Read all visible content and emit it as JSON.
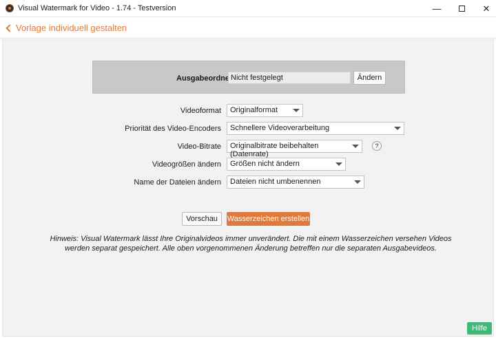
{
  "window": {
    "title": "Visual Watermark for Video - 1.74 - Testversion",
    "minimize": "—",
    "close": "✕"
  },
  "header": {
    "back_label": "Vorlage individuell gestalten"
  },
  "output": {
    "label": "Ausgabeordner",
    "value": "Nicht festgelegt",
    "change_button": "Ändern"
  },
  "form": {
    "videoformat": {
      "label": "Videoformat",
      "value": "Originalformat"
    },
    "encoder_priority": {
      "label": "Priorität des Video-Encoders",
      "value": "Schnellere Videoverarbeitung"
    },
    "bitrate": {
      "label": "Video-Bitrate",
      "value": "Originalbitrate beibehalten (Datenrate)",
      "help": "?"
    },
    "resize": {
      "label": "Videogrößen ändern",
      "value": "Größen nicht ändern"
    },
    "rename": {
      "label": "Name der Dateien ändern",
      "value": "Dateien nicht umbenennen"
    }
  },
  "actions": {
    "preview": "Vorschau",
    "create": "Wasserzeichen erstellen"
  },
  "hint": {
    "line1": "Hinweis: Visual Watermark lässt Ihre Originalvideos immer unverändert. Die mit einem Wasserzeichen versehen Videos",
    "line2": "werden separat gespeichert. Alle oben vorgenommenen Änderung betreffen nur die separaten Ausgabevideos."
  },
  "footer": {
    "help": "Hilfe"
  },
  "colors": {
    "accent": "#e07a3c",
    "help_button": "#3fb87a",
    "panel": "#c8c8c6"
  }
}
